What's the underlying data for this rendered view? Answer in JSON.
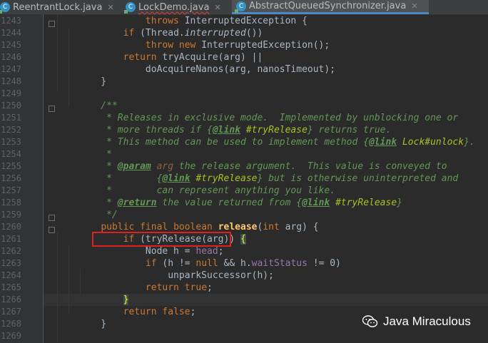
{
  "tabs": [
    {
      "label": "ReentrantLock.java",
      "active": false
    },
    {
      "label": "LockDemo.java",
      "active": false
    },
    {
      "label": "AbstractQueuedSynchronizer.java",
      "active": true
    }
  ],
  "editor": {
    "lines": [
      {
        "num": "1243",
        "text": "            throws InterruptedException {"
      },
      {
        "num": "1244",
        "text": "        if (Thread.interrupted())"
      },
      {
        "num": "1245",
        "text": "            throw new InterruptedException();"
      },
      {
        "num": "1246",
        "text": "        return tryAcquire(arg) ||"
      },
      {
        "num": "1247",
        "text": "            doAcquireNanos(arg, nanosTimeout);"
      },
      {
        "num": "1248",
        "text": "    }"
      },
      {
        "num": "1249",
        "text": ""
      },
      {
        "num": "1250",
        "text": "    /**"
      },
      {
        "num": "1251",
        "text": "     * Releases in exclusive mode.  Implemented by unblocking one or"
      },
      {
        "num": "1252",
        "text": "     * more threads if {@link #tryRelease} returns true."
      },
      {
        "num": "1253",
        "text": "     * This method can be used to implement method {@link Lock#unlock}."
      },
      {
        "num": "1254",
        "text": "     *"
      },
      {
        "num": "1255",
        "text": "     * @param arg the release argument.  This value is conveyed to"
      },
      {
        "num": "1256",
        "text": "     *        {@link #tryRelease} but is otherwise uninterpreted and"
      },
      {
        "num": "1257",
        "text": "     *        can represent anything you like."
      },
      {
        "num": "1258",
        "text": "     * @return the value returned from {@link #tryRelease}"
      },
      {
        "num": "1259",
        "text": "     */"
      },
      {
        "num": "1260",
        "text": "    public final boolean release(int arg) {"
      },
      {
        "num": "1261",
        "text": "        if (tryRelease(arg)) {"
      },
      {
        "num": "1262",
        "text": "            Node h = head;"
      },
      {
        "num": "1263",
        "text": "            if (h != null && h.waitStatus != 0)"
      },
      {
        "num": "1264",
        "text": "                unparkSuccessor(h);"
      },
      {
        "num": "1265",
        "text": "            return true;"
      },
      {
        "num": "1266",
        "text": "        }"
      },
      {
        "num": "1267",
        "text": "        return false;"
      },
      {
        "num": "1268",
        "text": "    }"
      },
      {
        "num": "1269",
        "text": ""
      }
    ]
  },
  "watermark": {
    "text": "Java Miraculous",
    "icon": "wechat-icon"
  },
  "colors": {
    "background": "#2b2b2b",
    "keyword": "#cc7832",
    "doc_comment": "#629755",
    "highlight_box": "#e02020",
    "active_tab_underline": "#4a88c7"
  }
}
